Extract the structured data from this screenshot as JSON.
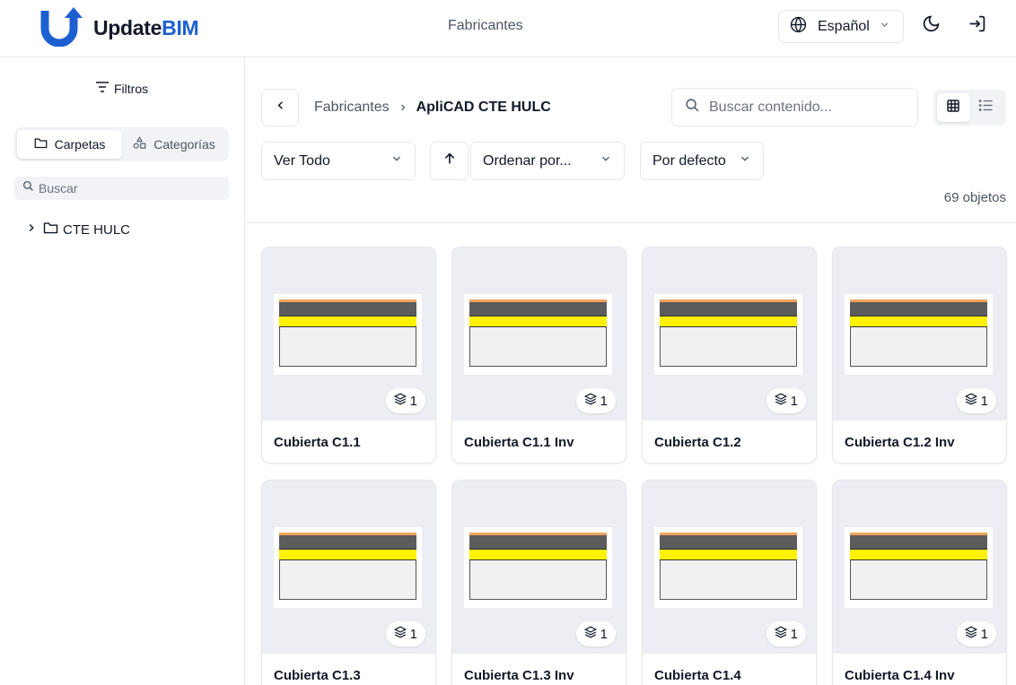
{
  "header": {
    "brand_part1": "Update",
    "brand_part2": "BIM",
    "center_link": "Fabricantes",
    "language": "Español",
    "colors": {
      "brand_blue": "#1d5fd1"
    }
  },
  "sidebar": {
    "filters_label": "Filtros",
    "segments": [
      {
        "label": "Carpetas",
        "icon": "folder-icon",
        "active": true
      },
      {
        "label": "Categorías",
        "icon": "shapes-icon",
        "active": false
      }
    ],
    "search_placeholder": "Buscar",
    "tree": [
      {
        "label": "CTE HULC",
        "icon": "folder-icon",
        "expanded": false
      }
    ]
  },
  "toolbar": {
    "breadcrumb": {
      "parent": "Fabricantes",
      "current": "ApliCAD CTE HULC"
    },
    "search_placeholder": "Buscar contenido...",
    "view_mode": "grid",
    "filter_select": "Ver Todo",
    "sort_select": "Ordenar por...",
    "order_select": "Por defecto",
    "count": "69 objetos"
  },
  "cards": [
    {
      "title": "Cubierta C1.1",
      "count": "1"
    },
    {
      "title": "Cubierta C1.1 Inv",
      "count": "1"
    },
    {
      "title": "Cubierta C1.2",
      "count": "1"
    },
    {
      "title": "Cubierta C1.2 Inv",
      "count": "1"
    },
    {
      "title": "Cubierta C1.3",
      "count": "1"
    },
    {
      "title": "Cubierta C1.3 Inv",
      "count": "1"
    },
    {
      "title": "Cubierta C1.4",
      "count": "1"
    },
    {
      "title": "Cubierta C1.4 Inv",
      "count": "1"
    }
  ]
}
